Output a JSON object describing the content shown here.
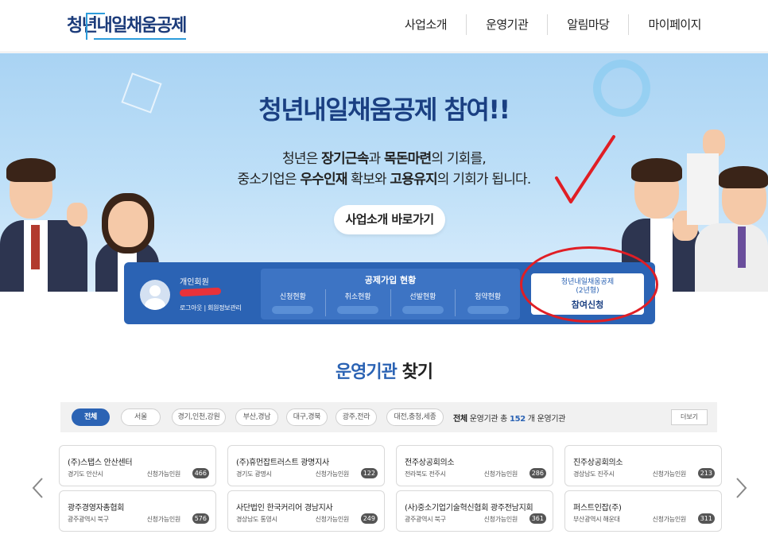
{
  "header": {
    "logo": "청년내일채움공제",
    "nav": [
      "사업소개",
      "운영기관",
      "알림마당",
      "마이페이지"
    ]
  },
  "hero": {
    "title": "청년내일채움공제 참여!!",
    "subtitle_line1": {
      "parts": [
        "청년은 ",
        "장기근속",
        "과 ",
        "목돈마련",
        "의 기회를,"
      ]
    },
    "subtitle_line2": {
      "parts": [
        "중소기업은 ",
        "우수인재",
        " 확보와 ",
        "고용유지",
        "의 기회가 됩니다."
      ]
    },
    "button": "사업소개 바로가기"
  },
  "status_bar": {
    "member_type": "개인회원",
    "member_links": "로그아웃 | 회원정보관리",
    "join_status_title": "공제가입 현황",
    "join_columns": [
      "신청현황",
      "취소현황",
      "선발현황",
      "청약현황"
    ],
    "apply_card_line1": "청년내일채움공제",
    "apply_card_line2": "(2년형)",
    "apply_card_action": "참여신청"
  },
  "find_section": {
    "title_accent": "운영기관",
    "title_rest": " 찾기",
    "filters": [
      "전체",
      "서울",
      "경기,인천,강원",
      "부산,경남",
      "대구,경북",
      "광주,전라",
      "대전,충청,세종"
    ],
    "active_filter": "전체",
    "summary_prefix": "전체",
    "summary_mid": " 운영기관 총 ",
    "summary_count": "152",
    "summary_suffix": " 개 운영기관",
    "more_button": "더보기",
    "count_label": "신청가능인원",
    "cards": [
      {
        "name": "(주)스탭스 안산센터",
        "region": "경기도 안산시",
        "count": "466"
      },
      {
        "name": "(주)휴먼잡트러스트 광명지사",
        "region": "경기도 광명시",
        "count": "122"
      },
      {
        "name": "전주상공회의소",
        "region": "전라북도 전주시",
        "count": "286"
      },
      {
        "name": "진주상공회의소",
        "region": "경상남도 진주시",
        "count": "213"
      },
      {
        "name": "광주경영자총협회",
        "region": "광주광역시 북구",
        "count": "576"
      },
      {
        "name": "사단법인 한국커리어 경남지사",
        "region": "경상남도 통영시",
        "count": "249"
      },
      {
        "name": "(사)중소기업기술혁신협회 광주전남지회",
        "region": "광주광역시 북구",
        "count": "361"
      },
      {
        "name": "퍼스트인잡(주)",
        "region": "부산광역시 해운대",
        "count": "311"
      }
    ]
  },
  "colors": {
    "brand_navy": "#1a3f82",
    "brand_blue": "#2b63b4",
    "annotation_red": "#e01e25"
  },
  "icons": [
    "prev-arrow-icon",
    "next-arrow-icon",
    "avatar-icon",
    "check-mark-annotation"
  ]
}
